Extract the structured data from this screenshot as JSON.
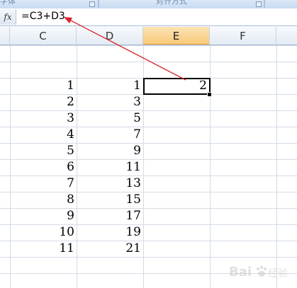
{
  "ribbon": {
    "group1_label": "字体",
    "group2_label": "对齐方式"
  },
  "formula_bar": {
    "fx_label": "fx",
    "formula": "=C3+D3"
  },
  "columns": [
    {
      "label": "C",
      "active": false
    },
    {
      "label": "D",
      "active": false
    },
    {
      "label": "E",
      "active": true
    },
    {
      "label": "F",
      "active": false
    }
  ],
  "rows": [
    {
      "c": "1",
      "d": "1",
      "e": "2"
    },
    {
      "c": "2",
      "d": "3",
      "e": ""
    },
    {
      "c": "3",
      "d": "5",
      "e": ""
    },
    {
      "c": "4",
      "d": "7",
      "e": ""
    },
    {
      "c": "5",
      "d": "9",
      "e": ""
    },
    {
      "c": "6",
      "d": "11",
      "e": ""
    },
    {
      "c": "7",
      "d": "13",
      "e": ""
    },
    {
      "c": "8",
      "d": "15",
      "e": ""
    },
    {
      "c": "9",
      "d": "17",
      "e": ""
    },
    {
      "c": "10",
      "d": "19",
      "e": ""
    },
    {
      "c": "11",
      "d": "21",
      "e": ""
    }
  ],
  "colors": {
    "annotation_arrow": "#d9232a",
    "active_header": "#f9c97a",
    "watermark": "#c8c8c8"
  },
  "watermark": {
    "text": "Bai 经验",
    "icon": "paw-logo-icon"
  }
}
